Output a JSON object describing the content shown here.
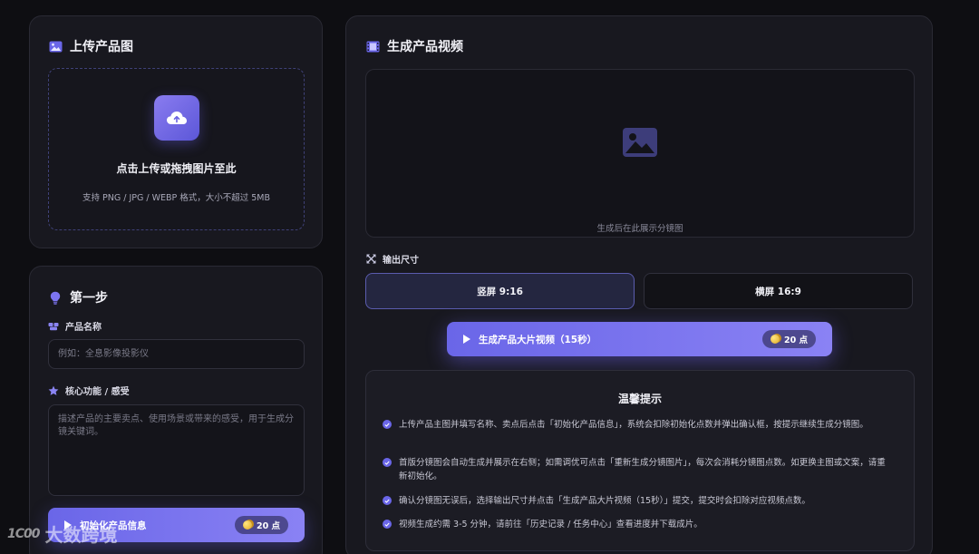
{
  "upload": {
    "title": "上传产品图",
    "main_text": "点击上传或拖拽图片至此",
    "hint": "支持 PNG / JPG / WEBP 格式，大小不超过 5MB"
  },
  "step": {
    "title": "第一步",
    "product_name_label": "产品名称",
    "product_name_placeholder": "例如：全息影像投影仪",
    "features_label": "核心功能 / 感受",
    "features_placeholder": "描述产品的主要卖点、使用场景或带来的感受，用于生成分镜关键词。",
    "init_button": "初始化产品信息",
    "init_cost": "20 点"
  },
  "video": {
    "title": "生成产品视频",
    "preview_hint": "生成后在此展示分镜图",
    "size_label": "输出尺寸",
    "size_portrait": "竖屏 9:16",
    "size_landscape": "横屏 16:9",
    "selected_size": "竖屏 9:16",
    "generate_button": "生成产品大片视频（15秒）",
    "generate_cost": "20 点"
  },
  "tips": {
    "title": "温馨提示",
    "items": [
      "上传产品主图并填写名称、卖点后点击「初始化产品信息」，系统会扣除初始化点数并弹出确认框，按提示继续生成分镜图。",
      "首版分镜图会自动生成并展示在右侧；如需调优可点击「重新生成分镜图片」，每次会消耗分镜图点数。如更换主图或文案，请重新初始化。",
      "确认分镜图无误后，选择输出尺寸并点击「生成产品大片视频（15秒）」提交，提交时会扣除对应视频点数。",
      "视频生成约需 3-5 分钟，请前往「历史记录 / 任务中心」查看进度并下载成片。"
    ]
  },
  "watermark": {
    "logo": "1C00",
    "text": "大数跨境"
  },
  "colors": {
    "accent": "#6a66e8",
    "background": "#0e0e12",
    "card": "#18181f"
  }
}
